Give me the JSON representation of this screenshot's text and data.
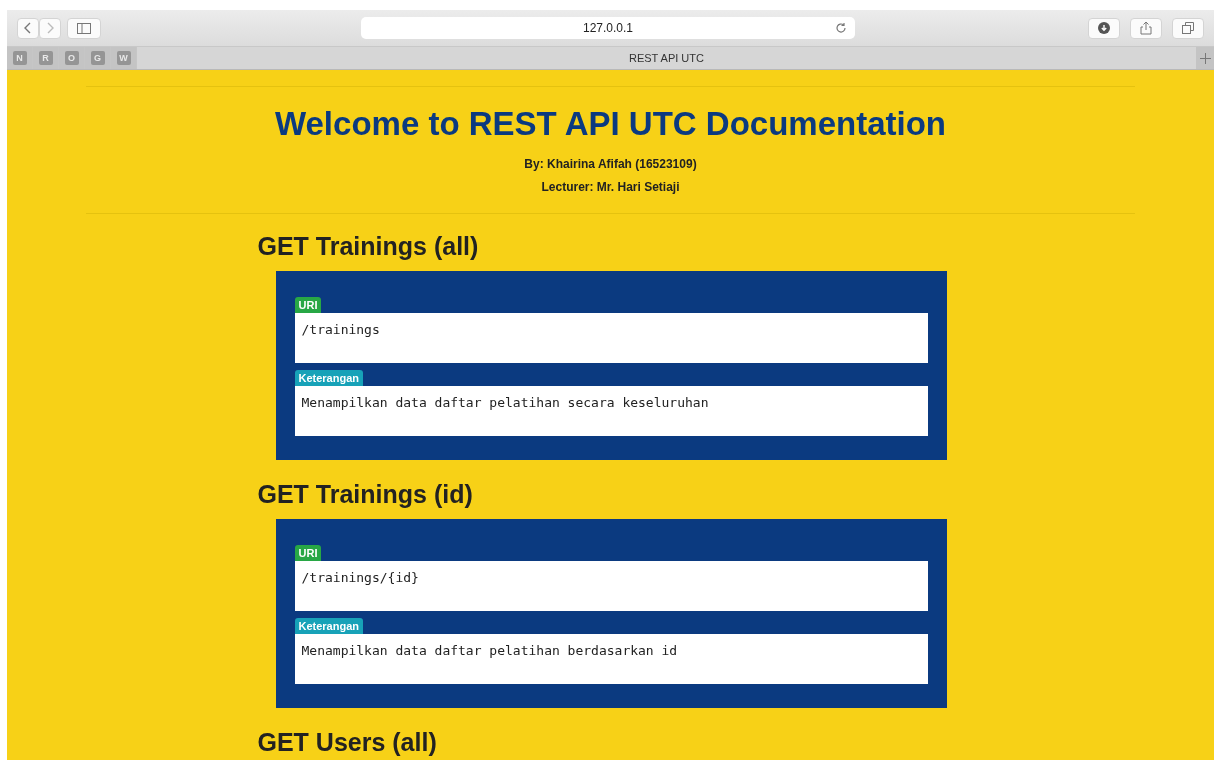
{
  "browser": {
    "address": "127.0.0.1",
    "tab_title": "REST API UTC",
    "bookmarks": [
      "N",
      "R",
      "O",
      "G",
      "W"
    ]
  },
  "header": {
    "title": "Welcome to REST API UTC Documentation",
    "author": "By: Khairina Afifah (16523109)",
    "lecturer": "Lecturer: Mr. Hari Setiaji"
  },
  "sections": [
    {
      "heading": "GET Trainings (all)",
      "uri_label": "URI",
      "uri": "/trainings",
      "desc_label": "Keterangan",
      "description": "Menampilkan data daftar pelatihan secara keseluruhan"
    },
    {
      "heading": "GET Trainings (id)",
      "uri_label": "URI",
      "uri": "/trainings/{id}",
      "desc_label": "Keterangan",
      "description": "Menampilkan data daftar pelatihan berdasarkan id"
    },
    {
      "heading": "GET Users (all)"
    }
  ]
}
